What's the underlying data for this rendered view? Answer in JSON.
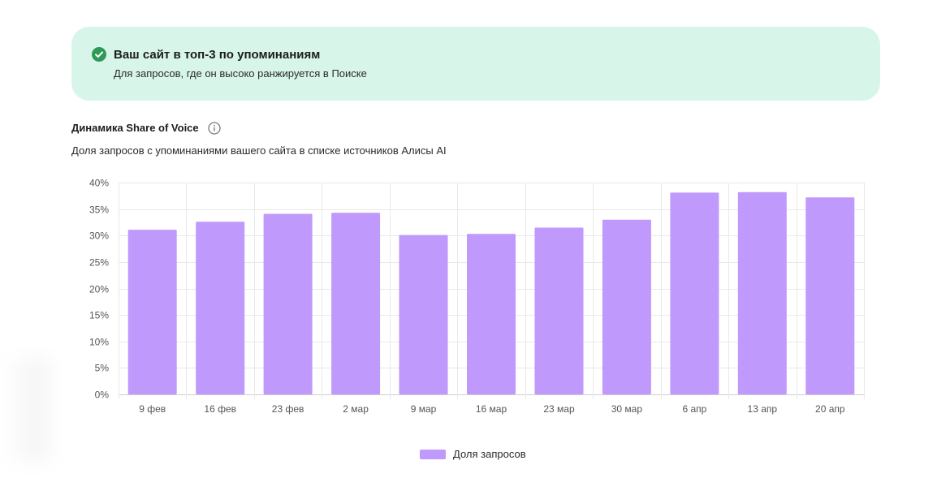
{
  "banner": {
    "title": "Ваш сайт в топ-3 по упоминаниям",
    "subtitle": "Для запросов, где он высоко ранжируется в Поиске",
    "icon": "check-circle-icon",
    "background_color": "#d8f5ea",
    "icon_color": "#2e9a56"
  },
  "section": {
    "title": "Динамика Share of Voice",
    "info_icon": "info-icon",
    "subtitle": "Доля запросов с упоминаниями вашего сайта в списке источников Алисы AI"
  },
  "chart_data": {
    "type": "bar",
    "categories": [
      "9 фев",
      "16 фев",
      "23 фев",
      "2 мар",
      "9 мар",
      "16 мар",
      "23 мар",
      "30 мар",
      "6 апр",
      "13 апр",
      "20 апр"
    ],
    "series": [
      {
        "name": "Доля запросов",
        "color": "#bf99fb",
        "values": [
          31.1,
          32.6,
          34.1,
          34.3,
          30.1,
          30.3,
          31.5,
          33.0,
          38.1,
          38.2,
          37.2
        ]
      }
    ],
    "y_ticks": [
      "0%",
      "5%",
      "10%",
      "15%",
      "20%",
      "25%",
      "30%",
      "35%",
      "40%"
    ],
    "ylim": [
      0,
      40
    ],
    "y_unit": "%",
    "grid": true,
    "legend_position": "bottom"
  }
}
